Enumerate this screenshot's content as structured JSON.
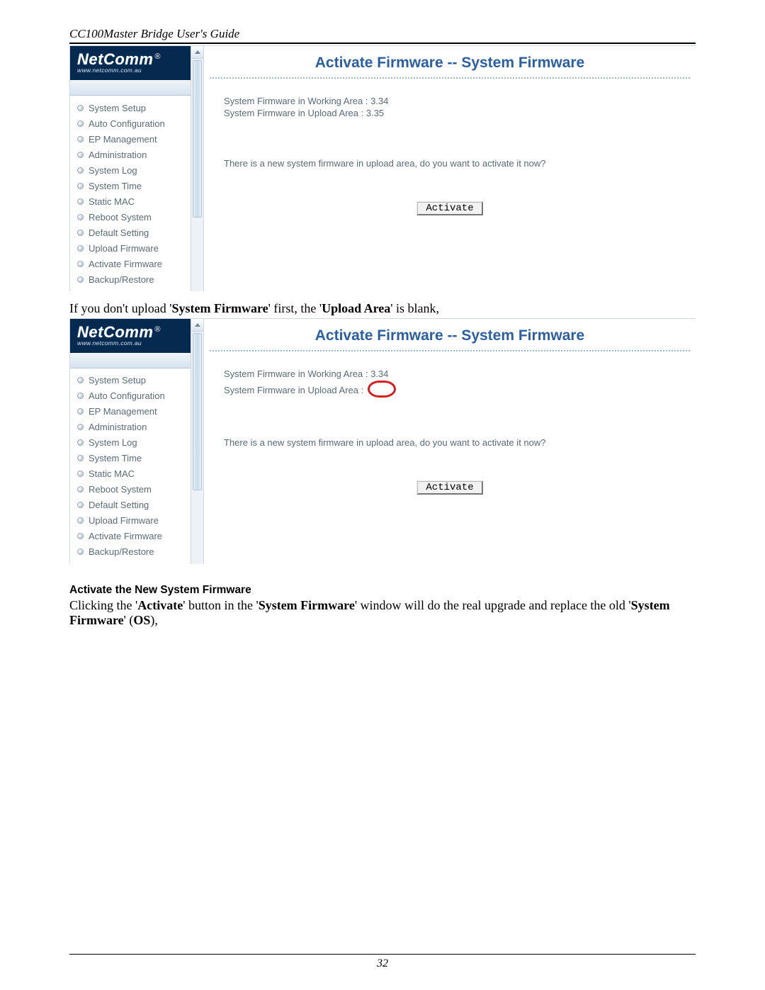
{
  "doc_header": "CC100Master Bridge User's Guide",
  "page_number": "32",
  "logo": {
    "brand": "NetComm",
    "registered": "®",
    "url": "www.netcomm.com.au"
  },
  "menu_items": [
    "System Setup",
    "Auto Configuration",
    "EP Management",
    "Administration",
    "System Log",
    "System Time",
    "Static MAC",
    "Reboot System",
    "Default Setting",
    "Upload Firmware",
    "Activate Firmware",
    "Backup/Restore"
  ],
  "panel1": {
    "title": "Activate Firmware -- System Firmware",
    "working_line": "System Firmware in Working Area : 3.34",
    "upload_line": "System Firmware in Upload Area : 3.35",
    "prompt": "There is a new system firmware in upload area, do you want to activate it now?",
    "button": "Activate"
  },
  "between_text": {
    "prefix": "If you don't upload '",
    "bold1": "System Firmware",
    "mid": "' first, the '",
    "bold2": "Upload Area",
    "suffix": "' is blank,"
  },
  "panel2": {
    "title": "Activate Firmware -- System Firmware",
    "working_line": "System Firmware in Working Area : 3.34",
    "upload_prefix": "System Firmware in Upload Area : ",
    "prompt": "There is a new system firmware in upload area, do you want to activate it now?",
    "button": "Activate"
  },
  "section_heading": "Activate the New System Firmware",
  "final_para": {
    "p1": "Clicking the '",
    "b1": "Activate",
    "p2": "' button in the '",
    "b2": "System Firmware",
    "p3": "' window will do the real upgrade and replace the old '",
    "b3": "System Firmware",
    "p4": "' (",
    "b4": "OS",
    "p5": "),"
  }
}
